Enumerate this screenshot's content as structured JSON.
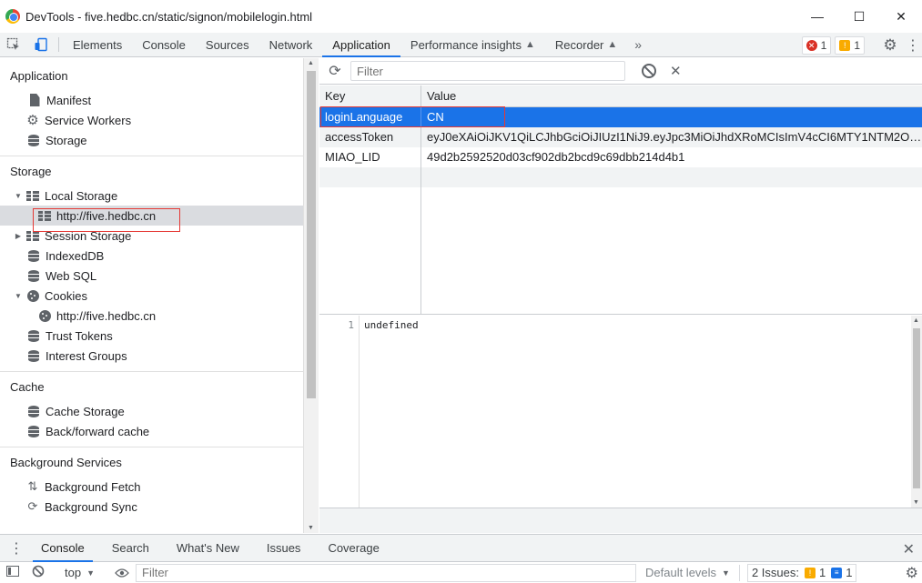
{
  "window": {
    "title": "DevTools - five.hedbc.cn/static/signon/mobilelogin.html",
    "minimize": "—",
    "maximize": "☐",
    "close": "✕"
  },
  "toolbar": {
    "tabs": [
      "Elements",
      "Console",
      "Sources",
      "Network",
      "Application",
      "Performance insights",
      "Recorder"
    ],
    "selected_tab": "Application",
    "more": "»",
    "error_count": "1",
    "warning_count": "1"
  },
  "sidebar": {
    "application_header": "Application",
    "application_items": [
      "Manifest",
      "Service Workers",
      "Storage"
    ],
    "storage_header": "Storage",
    "local_storage": "Local Storage",
    "local_storage_origin": "http://five.hedbc.cn",
    "session_storage": "Session Storage",
    "indexeddb": "IndexedDB",
    "websql": "Web SQL",
    "cookies": "Cookies",
    "cookies_origin": "http://five.hedbc.cn",
    "trust_tokens": "Trust Tokens",
    "interest_groups": "Interest Groups",
    "cache_header": "Cache",
    "cache_items": [
      "Cache Storage",
      "Back/forward cache"
    ],
    "background_header": "Background Services",
    "background_items": [
      "Background Fetch",
      "Background Sync"
    ]
  },
  "main": {
    "filter_placeholder": "Filter",
    "columns": {
      "key": "Key",
      "value": "Value"
    },
    "rows": [
      {
        "key": "loginLanguage",
        "value": "CN"
      },
      {
        "key": "accessToken",
        "value": "eyJ0eXAiOiJKV1QiLCJhbGciOiJIUzI1NiJ9.eyJpc3MiOiJhdXRoMCIsImV4cCI6MTY1NTM2OD…"
      },
      {
        "key": "MIAO_LID",
        "value": "49d2b2592520d03cf902db2bcd9c69dbb214d4b1"
      }
    ],
    "selected_row": "loginLanguage",
    "preview_line_number": "1",
    "preview_value": "undefined"
  },
  "drawer": {
    "tabs": [
      "Console",
      "Search",
      "What's New",
      "Issues",
      "Coverage"
    ],
    "selected_tab": "Console",
    "context": "top",
    "filter_placeholder": "Filter",
    "levels": "Default levels",
    "issues_label": "2 Issues:",
    "issues_warning": "1",
    "issues_info": "1"
  },
  "colors": {
    "accent": "#1a73e8",
    "highlight_box": "#e53935",
    "error": "#d93025",
    "warning": "#f9ab00"
  }
}
